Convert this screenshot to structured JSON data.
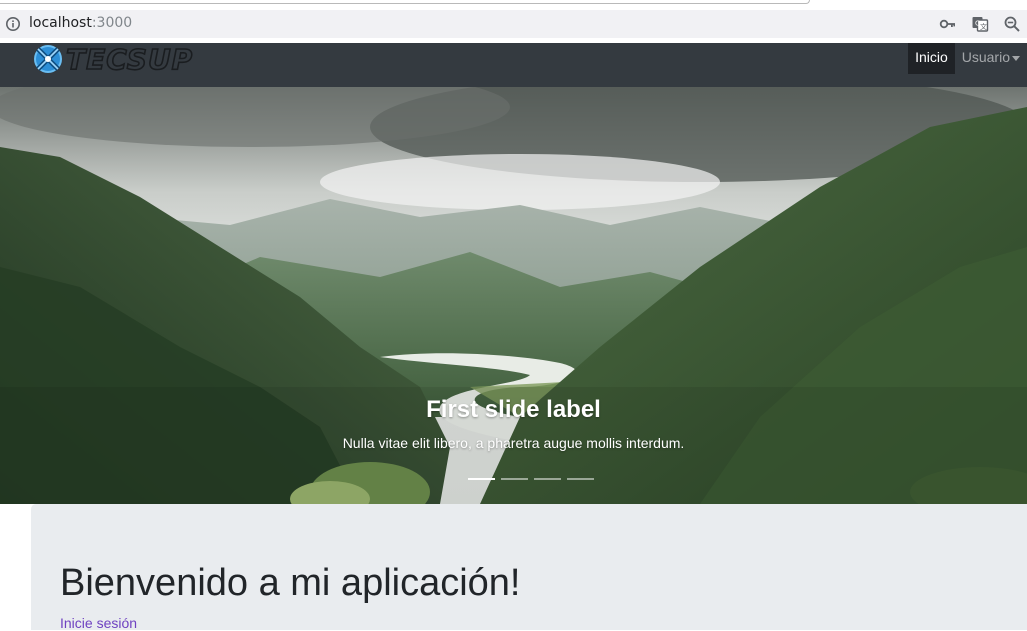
{
  "browser": {
    "url_host": "localhost",
    "url_port": ":3000",
    "icons": [
      "info-icon",
      "key-icon",
      "translate-icon",
      "zoom-out-icon"
    ]
  },
  "navbar": {
    "brand_text": "TECSUP",
    "links": [
      {
        "label": "Inicio",
        "active": true
      },
      {
        "label": "Usuario",
        "dropdown": true
      }
    ],
    "background": "#343a40"
  },
  "carousel": {
    "slide_title": "First slide label",
    "slide_text": "Nulla vitae elit libero, a pharetra augue mollis interdum.",
    "indicator_count": 4,
    "active_indicator": 0
  },
  "jumbotron": {
    "heading": "Bienvenido a mi aplicación!",
    "link_label": "Inicie sesión",
    "background": "#e9ecef",
    "link_color": "#6f42c1"
  }
}
